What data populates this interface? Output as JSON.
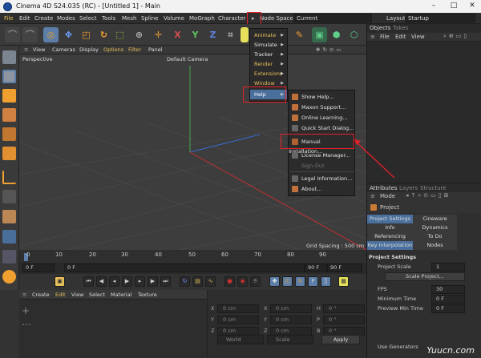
{
  "window": {
    "title": "Cinema 4D S24.035 (RC) - [Untitled 1] - Main",
    "minimize": "–",
    "maximize": "□",
    "close": "✕"
  },
  "menubar": {
    "items": [
      "File",
      "Edit",
      "Create",
      "Modes",
      "Select",
      "Tools",
      "Mesh",
      "Spline",
      "Volume",
      "MoGraph",
      "Character",
      "▸",
      "Node Space:"
    ],
    "node_space_value": "Current (Standard/Physical)",
    "layout_label": "Layout:",
    "layout_value": "Startup"
  },
  "toolbar": {
    "icons": [
      "undo-icon",
      "redo-icon",
      "live-selection-icon",
      "move-icon",
      "scale-icon",
      "rotate-icon",
      "model-mode-icon",
      "axis-icon",
      "snap-icon",
      "x-axis-icon",
      "y-axis-icon",
      "z-axis-icon",
      "coordinate-system-icon",
      "render-view-icon"
    ],
    "x": "X",
    "y": "Y",
    "z": "Z"
  },
  "viewport": {
    "menu": [
      "View",
      "Cameras",
      "Display",
      "Options",
      "Filter",
      "Panel"
    ],
    "projection": "Perspective",
    "camera": "Default Camera",
    "grid_spacing": "Grid Spacing : 500 cm"
  },
  "overflow_menu": {
    "items": [
      "Animate",
      "Simulate",
      "Tracker",
      "Render",
      "Extensions",
      "Window",
      "Help"
    ],
    "highlighted": "Help"
  },
  "help_menu": {
    "items": [
      "Show Help...",
      "Maxon Support...",
      "Online Learning...",
      "Quick Start Dialog...",
      "Manual Installation...",
      "License Manager...",
      "Sign-Out",
      "Legal Information...",
      "About..."
    ],
    "highlighted": "Manual Installation..."
  },
  "timeline": {
    "ticks": [
      "0",
      "10",
      "20",
      "30",
      "40",
      "50",
      "60",
      "70",
      "80",
      "90"
    ],
    "frame_start": "0 F",
    "frame_current": "0 F",
    "frame_end": "90 F",
    "frame_max": "90 F"
  },
  "materials": {
    "menu": [
      "Create",
      "Edit",
      "View",
      "Select",
      "Material",
      "Texture"
    ]
  },
  "coordinates": {
    "rows": [
      {
        "axis1": "X",
        "val1": "0 cm",
        "axis2": "X",
        "val2": "0 cm",
        "axis3": "H",
        "val3": "0 °"
      },
      {
        "axis1": "Y",
        "val1": "0 cm",
        "axis2": "Y",
        "val2": "0 cm",
        "axis3": "P",
        "val3": "0 °"
      },
      {
        "axis1": "Z",
        "val1": "0 cm",
        "axis2": "Z",
        "val2": "0 cm",
        "axis3": "B",
        "val3": "0 °"
      }
    ],
    "world": "World",
    "scale": "Scale",
    "apply": "Apply"
  },
  "objects": {
    "tabs": [
      "Objects",
      "Takes"
    ],
    "menu": [
      "File",
      "Edit",
      "View"
    ]
  },
  "attributes": {
    "tabs": [
      "Attributes",
      "Layers",
      "Structure"
    ],
    "mode": "Mode",
    "project_label": "Project",
    "grid_buttons": [
      "Project Settings",
      "Cineware",
      "Info",
      "Dynamics",
      "Referencing",
      "To Do",
      "Key Interpolation",
      "Nodes"
    ],
    "section": "Project Settings",
    "fields": [
      {
        "label": "Project Scale",
        "value": "1"
      },
      {
        "label": "Scale Project...",
        "value": ""
      },
      {
        "label": "FPS",
        "value": "30"
      },
      {
        "label": "Minimum Time",
        "value": "0 F"
      },
      {
        "label": "Preview Min Time",
        "value": "0 F"
      }
    ],
    "last_row": "Use Generators"
  },
  "watermark": "Yuucn.com",
  "colors": {
    "accent": "#5c7ea8",
    "highlight": "#e8202a",
    "menu_yellow": "#e8c05a",
    "x_axis": "#c33",
    "y_axis": "#3a3",
    "z_axis": "#35c"
  }
}
